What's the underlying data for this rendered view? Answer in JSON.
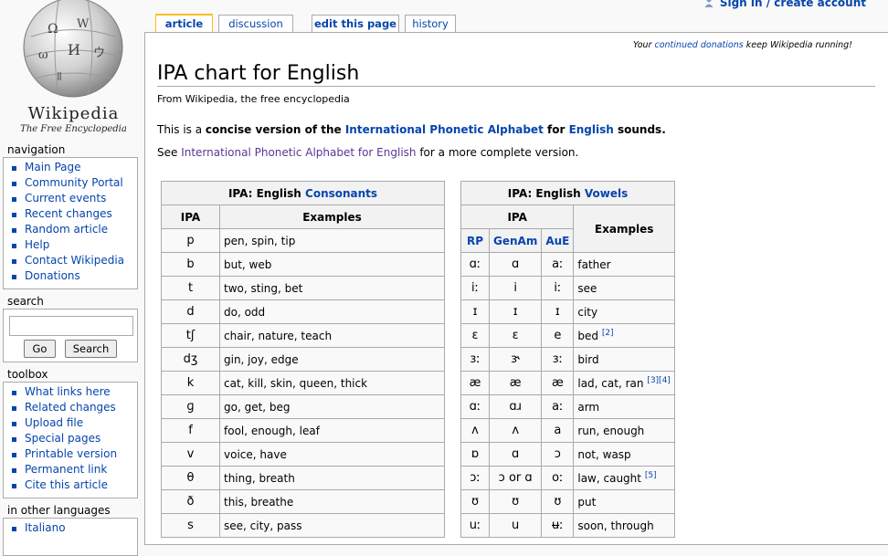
{
  "personal": {
    "label": "Sign in / create account",
    "icon": "user-icon"
  },
  "logo": {
    "word": "Wikipedia",
    "tagline": "The Free Encyclopedia"
  },
  "tabs": [
    "article",
    "discussion",
    "edit this page",
    "history"
  ],
  "sitenotice": {
    "pre": "Your ",
    "link": "continued donations",
    "post": " keep Wikipedia running!"
  },
  "page": {
    "title": "IPA chart for English",
    "subtitle": "From Wikipedia, the free encyclopedia",
    "intro1": {
      "a": "This is a ",
      "b": "concise version of the ",
      "c": "International Phonetic Alphabet",
      "d": " for ",
      "e": "English",
      "f": " sounds."
    },
    "intro2": {
      "a": "See ",
      "b": "International Phonetic Alphabet for English",
      "c": " for a more complete version."
    }
  },
  "consonants": {
    "caption_pre": "IPA: English ",
    "caption_link": "Consonants",
    "headers": [
      "IPA",
      "Examples"
    ],
    "rows": [
      [
        "p",
        "pen, spin, tip"
      ],
      [
        "b",
        "but, web"
      ],
      [
        "t",
        "two, sting, bet"
      ],
      [
        "d",
        "do, odd"
      ],
      [
        "tʃ",
        "chair, nature, teach"
      ],
      [
        "dʒ",
        "gin, joy, edge"
      ],
      [
        "k",
        "cat, kill, skin, queen, thick"
      ],
      [
        "ɡ",
        "go, get, beg"
      ],
      [
        "f",
        "fool, enough, leaf"
      ],
      [
        "v",
        "voice, have"
      ],
      [
        "θ",
        "thing, breath"
      ],
      [
        "ð",
        "this, breathe"
      ],
      [
        "s",
        "see, city, pass"
      ]
    ]
  },
  "vowels": {
    "caption_pre": "IPA: English ",
    "caption_link": "Vowels",
    "headers": [
      "IPA",
      "Examples"
    ],
    "subheaders": [
      "RP",
      "GenAm",
      "AuE"
    ],
    "rows": [
      [
        "ɑː",
        "ɑ",
        "aː",
        "father",
        ""
      ],
      [
        "iː",
        "i",
        "iː",
        "see",
        ""
      ],
      [
        "ɪ",
        "ɪ",
        "ɪ",
        "city",
        ""
      ],
      [
        "ɛ",
        "ɛ",
        "e",
        "bed",
        "[2]"
      ],
      [
        "ɜː",
        "ɝ",
        "ɜː",
        "bird",
        ""
      ],
      [
        "æ",
        "æ",
        "æ",
        "lad, cat, ran",
        "[3][4]"
      ],
      [
        "ɑː",
        "ɑɹ",
        "aː",
        "arm",
        ""
      ],
      [
        "ʌ",
        "ʌ",
        "a",
        "run, enough",
        ""
      ],
      [
        "ɒ",
        "ɑ",
        "ɔ",
        "not, wasp",
        ""
      ],
      [
        "ɔː",
        "ɔ or ɑ",
        "oː",
        "law, caught",
        "[5]"
      ],
      [
        "ʊ",
        "ʊ",
        "ʊ",
        "put",
        ""
      ],
      [
        "uː",
        "u",
        "ʉː",
        "soon, through",
        ""
      ]
    ]
  },
  "navigation": {
    "title": "navigation",
    "items": [
      "Main Page",
      "Community Portal",
      "Current events",
      "Recent changes",
      "Random article",
      "Help",
      "Contact Wikipedia",
      "Donations"
    ]
  },
  "search": {
    "title": "search",
    "go": "Go",
    "search": "Search"
  },
  "toolbox": {
    "title": "toolbox",
    "items": [
      "What links here",
      "Related changes",
      "Upload file",
      "Special pages",
      "Printable version",
      "Permanent link",
      "Cite this article"
    ]
  },
  "languages": {
    "title": "in other languages",
    "items": [
      "Italiano"
    ]
  }
}
